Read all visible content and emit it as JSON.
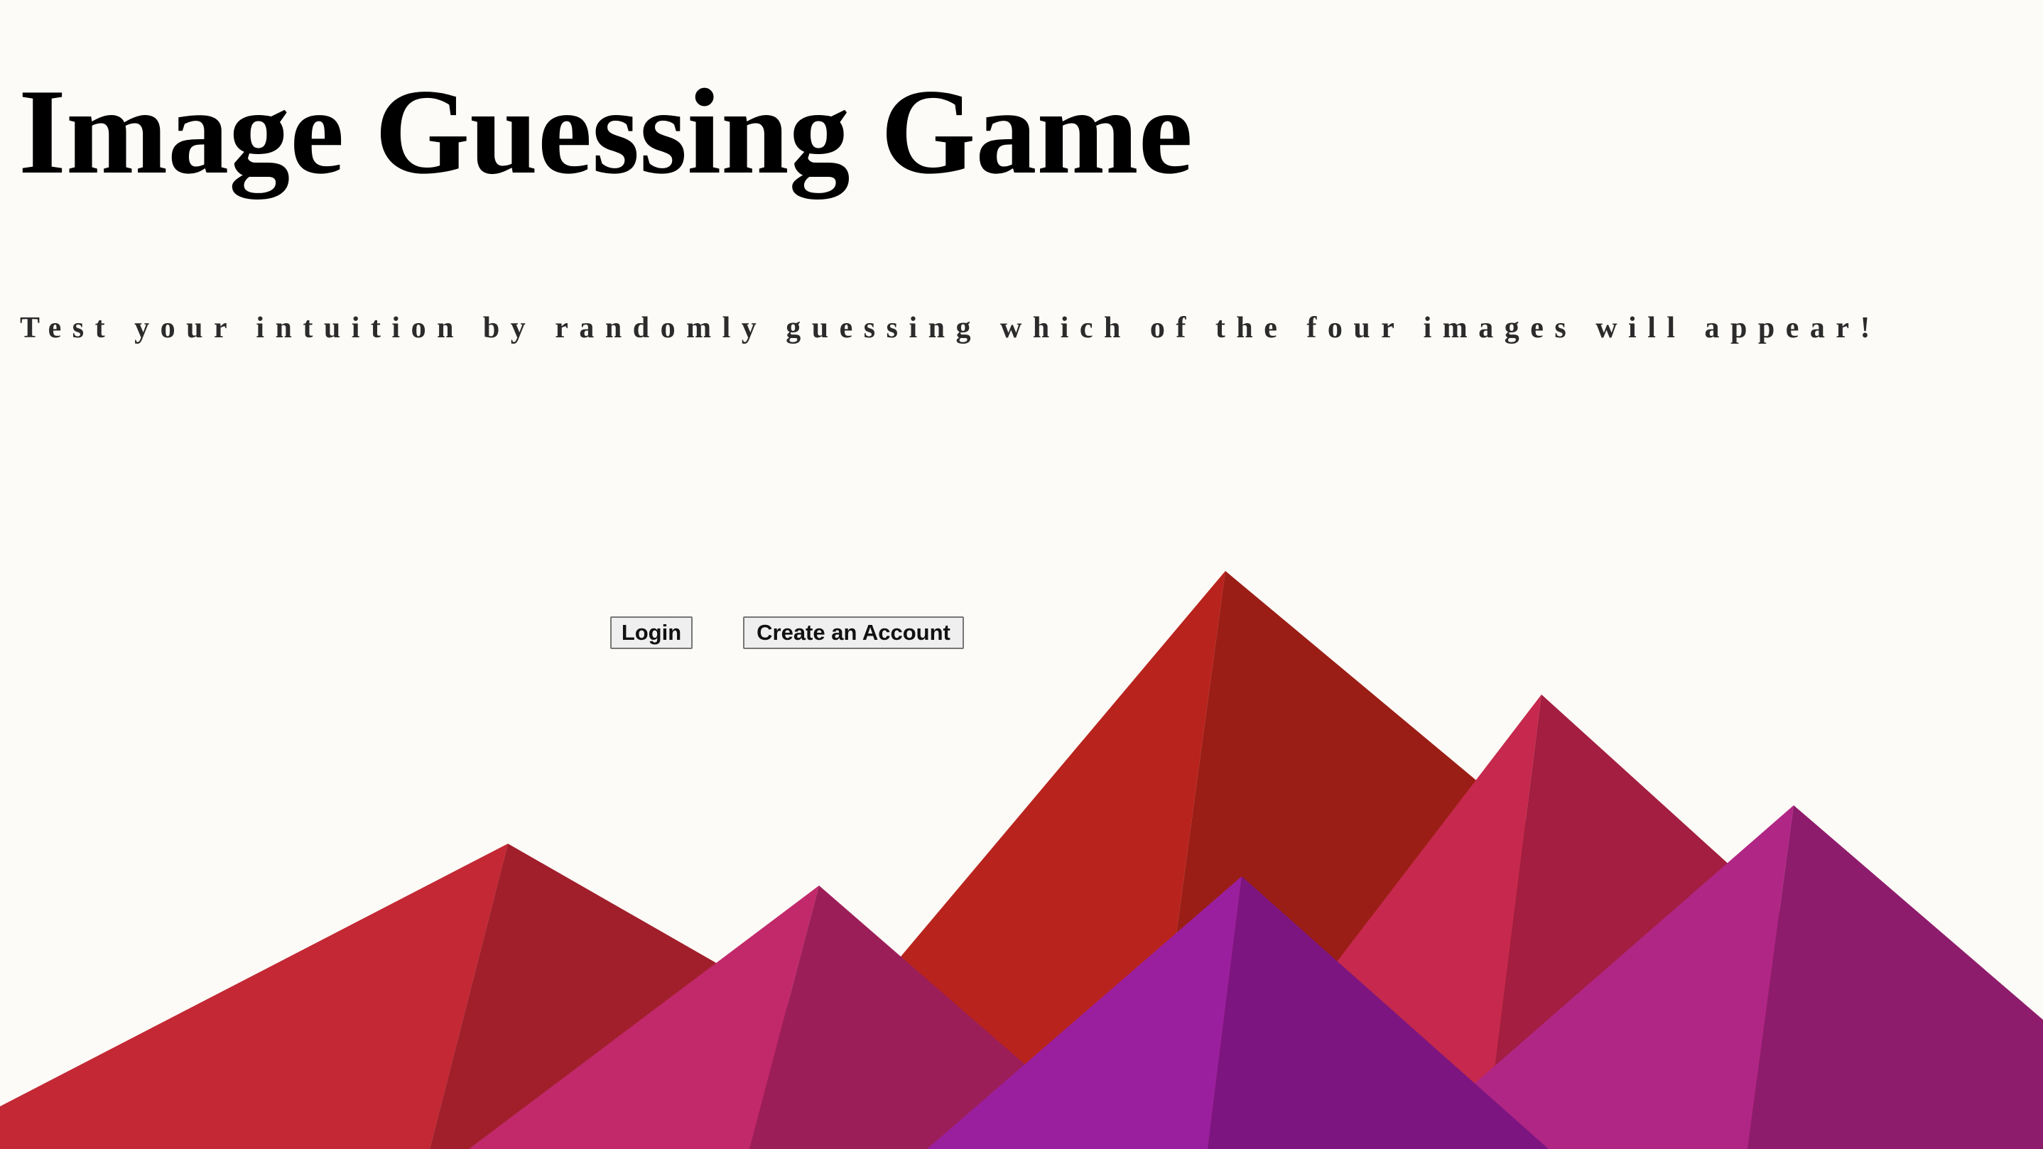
{
  "header": {
    "title": "Image Guessing Game",
    "subtitle": "Test your intuition by randomly guessing which of the four images will appear!"
  },
  "actions": {
    "login_label": "Login",
    "create_account_label": "Create an Account"
  },
  "colors": {
    "background": "#fdfbf7",
    "mountain_red": "#b9231d",
    "mountain_crimson": "#c32834",
    "mountain_pink": "#c1296b",
    "mountain_purple": "#9a1f9f",
    "mountain_magenta": "#b02685"
  }
}
